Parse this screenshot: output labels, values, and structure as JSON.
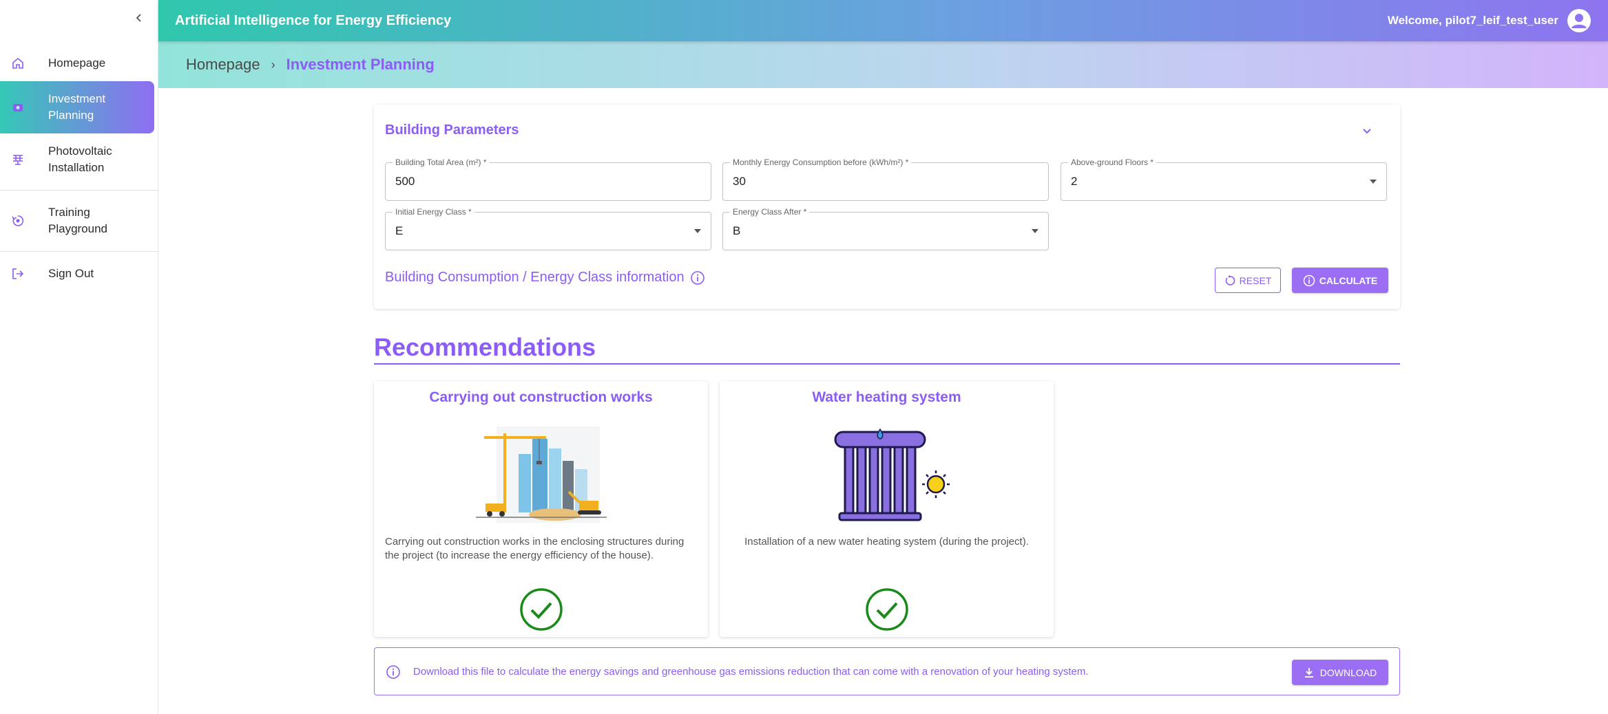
{
  "app": {
    "title": "Artificial Intelligence for Energy Efficiency",
    "welcome": "Welcome, pilot7_leif_test_user"
  },
  "sidebar": {
    "items": [
      {
        "label": "Homepage",
        "icon": "home-icon"
      },
      {
        "label": "Investment\nPlanning",
        "icon": "investment-icon",
        "active": true
      },
      {
        "label": "Photovoltaic\nInstallation",
        "icon": "solar-panel-icon"
      },
      {
        "label": "Training\nPlayground",
        "icon": "training-icon"
      },
      {
        "label": "Sign Out",
        "icon": "sign-out-icon"
      }
    ]
  },
  "breadcrumb": {
    "home": "Homepage",
    "separator": "›",
    "current": "Investment Planning"
  },
  "params": {
    "title": "Building Parameters",
    "fields": {
      "area": {
        "label": "Building Total Area (m²) *",
        "value": "500"
      },
      "consumption": {
        "label": "Monthly Energy Consumption before (kWh/m²) *",
        "value": "30"
      },
      "floors": {
        "label": "Above-ground Floors *",
        "value": "2"
      },
      "initial_class": {
        "label": "Initial Energy Class *",
        "value": "E"
      },
      "class_after": {
        "label": "Energy Class After *",
        "value": "B"
      }
    },
    "info_text": "Building Consumption / Energy Class information",
    "reset_label": "RESET",
    "calculate_label": "CALCULATE"
  },
  "recommendations": {
    "title": "Recommendations",
    "cards": [
      {
        "title": "Carrying out construction works",
        "description": "Carrying out construction works in the enclosing structures during the project (to increase the energy efficiency of the house).",
        "status": "check-icon"
      },
      {
        "title": "Water heating system",
        "description": "Installation of a new water heating system (during the project).",
        "status": "check-icon"
      }
    ]
  },
  "download": {
    "text": "Download this file to calculate the energy savings and greenhouse gas emissions reduction that can come with a renovation of your heating system.",
    "button_label": "DOWNLOAD"
  },
  "colors": {
    "accent": "#8b5cf6",
    "teal": "#2fc7ad",
    "success": "#1a8a1a"
  }
}
